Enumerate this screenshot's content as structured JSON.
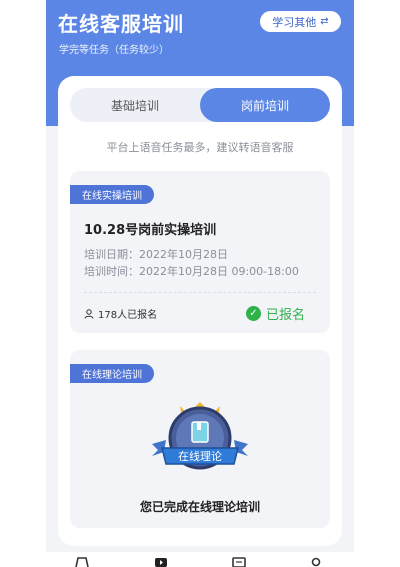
{
  "header": {
    "title": "在线客服培训",
    "subtitle": "学完等任务（任务较少）",
    "switch_label": "学习其他",
    "switch_icon": "swap-icon"
  },
  "tabs": [
    {
      "label": "基础培训",
      "active": false
    },
    {
      "label": "岗前培训",
      "active": true
    }
  ],
  "hint": "平台上语音任务最多，建议转语音客服",
  "practical": {
    "tag": "在线实操培训",
    "title": "10.28号岗前实操培训",
    "date_line": "培训日期：2022年10月28日",
    "time_line": "培训时间：2022年10月28日 09:00-18:00",
    "enrolled": "178人已报名",
    "status": "已报名"
  },
  "theory": {
    "tag": "在线理论培训",
    "badge_text": "在线理论",
    "completed": "您已完成在线理论培训"
  },
  "colors": {
    "primary": "#5b86e5",
    "tag": "#4f74d8",
    "success": "#2fb24a"
  },
  "bottom_nav_icons": [
    "home-icon",
    "play-icon",
    "list-icon",
    "user-icon"
  ]
}
